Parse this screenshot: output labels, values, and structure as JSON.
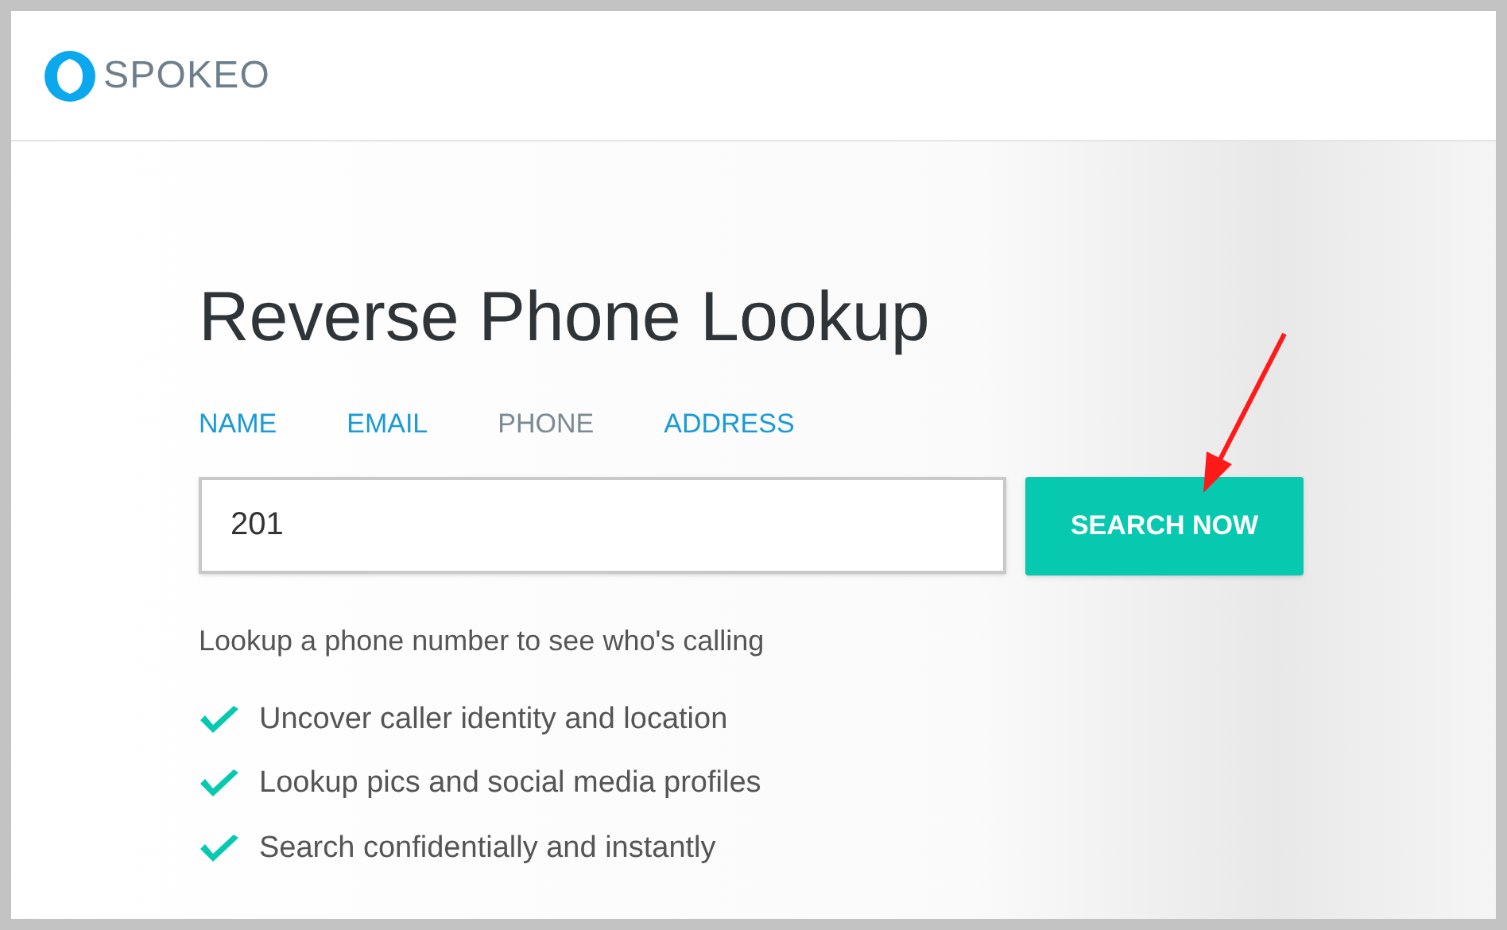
{
  "header": {
    "brand": "SPOKEO"
  },
  "page": {
    "title": "Reverse Phone Lookup",
    "tabs": [
      {
        "label": "NAME",
        "selected": false
      },
      {
        "label": "EMAIL",
        "selected": false
      },
      {
        "label": "PHONE",
        "selected": true
      },
      {
        "label": "ADDRESS",
        "selected": false
      }
    ],
    "search": {
      "value": "201"
    },
    "button": "SEARCH NOW",
    "subtitle": "Lookup a phone number to see who's calling",
    "features": [
      "Uncover caller identity and location",
      "Lookup pics and social media profiles",
      "Search confidentially and instantly"
    ]
  }
}
